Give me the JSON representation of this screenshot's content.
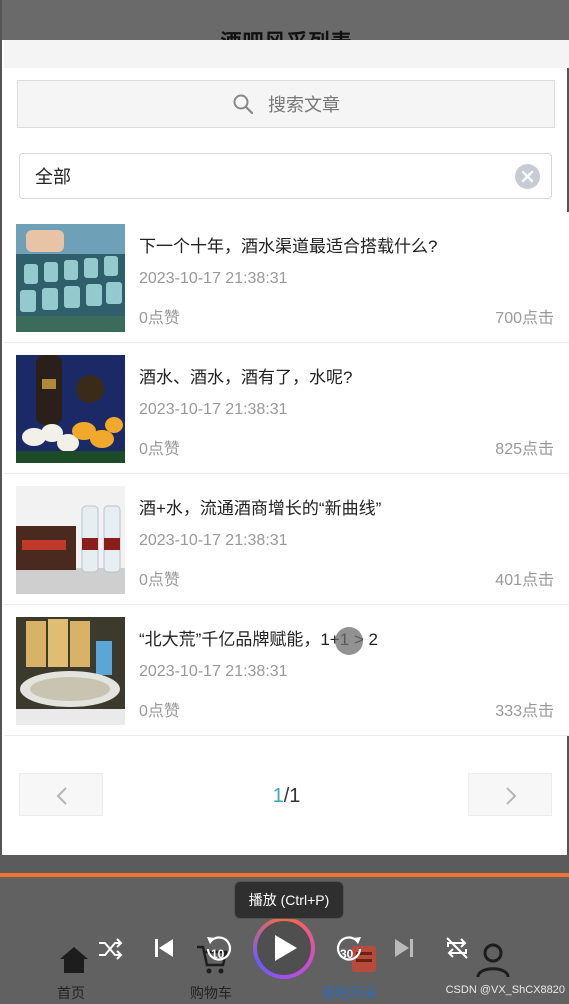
{
  "page_title": "酒吧风采列表",
  "search": {
    "placeholder": "搜索文章",
    "icon": "search-icon"
  },
  "filter": {
    "value": "全部",
    "clear_icon": "clear-icon"
  },
  "articles": [
    {
      "title": "下一个十年，酒水渠道最适合搭载什么?",
      "date": "2023-10-17 21:38:31",
      "likes": "0点赞",
      "clicks": "700点击"
    },
    {
      "title": "酒水、酒水，酒有了，水呢?",
      "date": "2023-10-17 21:38:31",
      "likes": "0点赞",
      "clicks": "825点击"
    },
    {
      "title": "酒+水，流通酒商增长的“新曲线”",
      "date": "2023-10-17 21:38:31",
      "likes": "0点赞",
      "clicks": "401点击"
    },
    {
      "title": "“北大荒”千亿品牌赋能，1+1 > 2",
      "date": "2023-10-17 21:38:31",
      "likes": "0点赞",
      "clicks": "333点击"
    }
  ],
  "pagination": {
    "current": "1",
    "total": "/1"
  },
  "tooltip": "播放 (Ctrl+P)",
  "tabs": {
    "home": "首页",
    "cart": "购物车",
    "bar": "酒吧风采"
  },
  "player": {
    "skip_back": "10",
    "skip_forward": "30"
  },
  "watermark": "CSDN @VX_ShCX8820",
  "colors": {
    "accent": "#3aa7b4",
    "progress": "#f0732e"
  }
}
